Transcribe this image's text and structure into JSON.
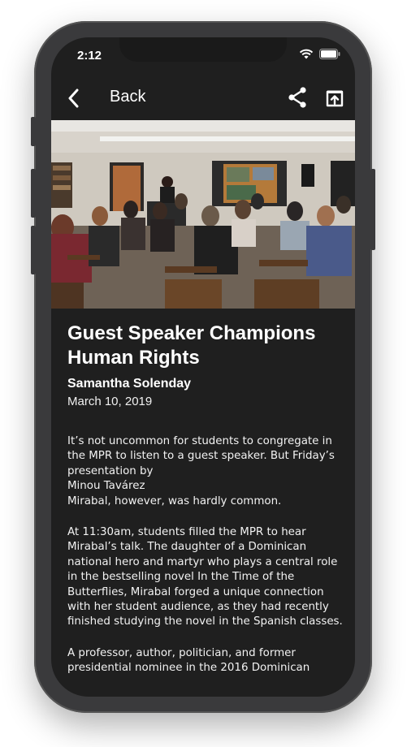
{
  "status_bar": {
    "time": "2:12"
  },
  "navbar": {
    "back_label": "Back"
  },
  "article": {
    "title": "Guest Speaker Champions Human Rights",
    "author": "Samantha Solenday",
    "date": "March 10, 2019",
    "paragraphs": [
      "It’s not uncommon for students to congregate in the MPR to listen to a guest speaker. But Friday’s presentation by\nMinou  Tavárez\n Mirabal, however, was hardly common.",
      "At 11:30am, students filled the MPR to hear Mirabal’s talk. The daughter of a Dominican national hero and martyr who plays a central role in the bestselling novel In the Time of the Butterflies, Mirabal forged a unique connection with her student audience, as they had recently finished studying the novel in the Spanish classes.",
      "A professor, author, politician, and former presidential nominee in the 2016 Dominican"
    ]
  }
}
